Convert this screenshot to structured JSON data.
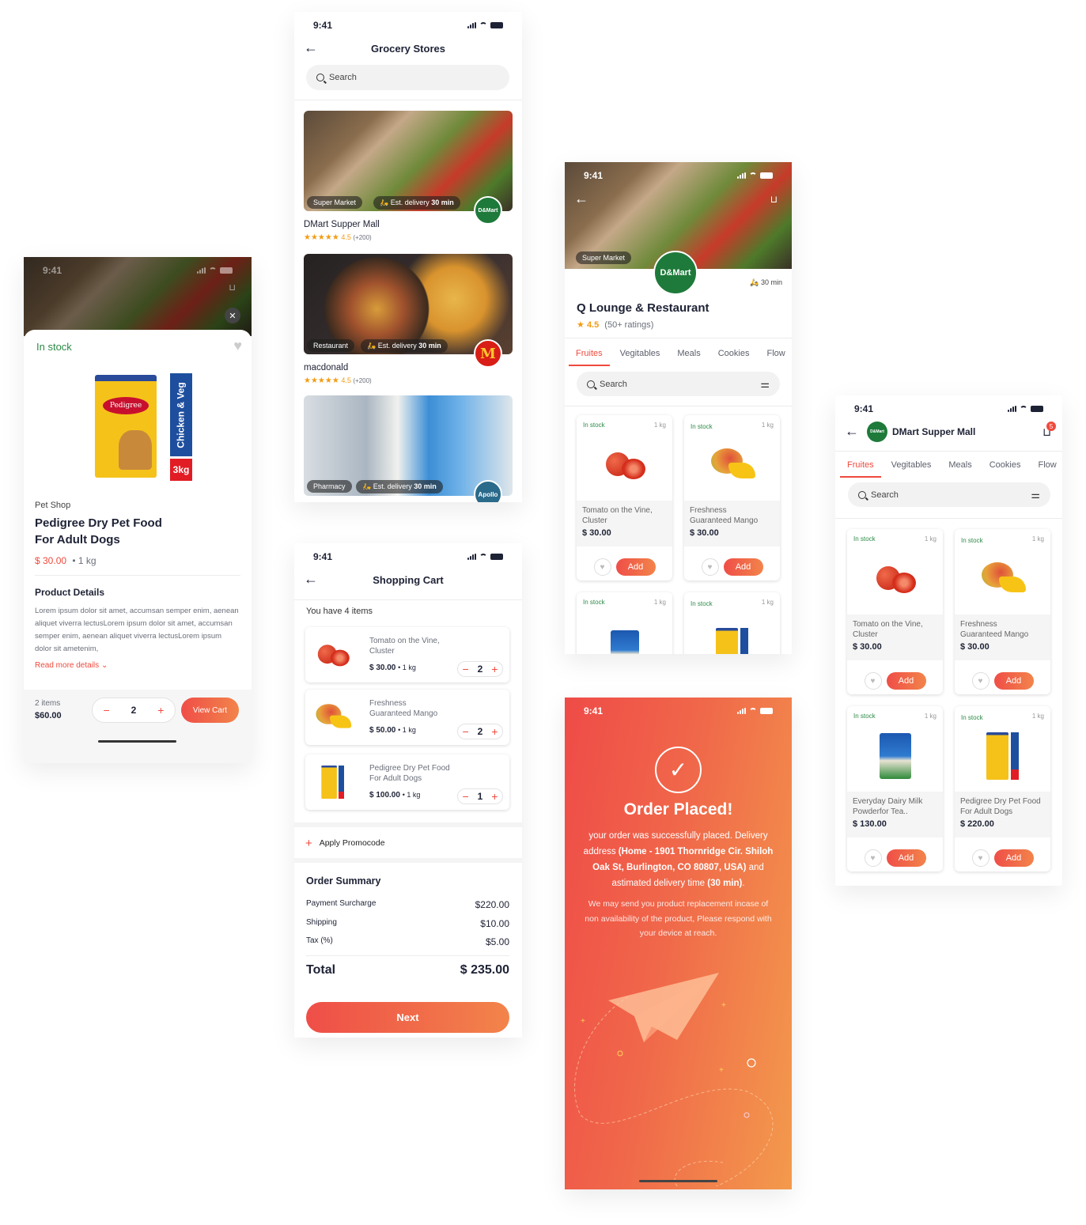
{
  "status_time": "9:41",
  "product_detail": {
    "stock": "In stock",
    "shop": "Pet Shop",
    "title_line1": "Pedigree Dry Pet Food",
    "title_line2": "For Adult Dogs",
    "price": "$ 30.00",
    "unit": "• 1 kg",
    "section_title": "Product Details",
    "description": "Lorem ipsum dolor sit amet, accumsan semper enim, aenean aliquet viverra lectusLorem ipsum dolor sit amet, accumsan semper enim, aenean aliquet viverra lectusLorem ipsum dolor sit ametenim,",
    "read_more": "Read more details",
    "pack_label": "Chicken & Veg",
    "pack_weight": "3kg",
    "footer": {
      "items": "2 items",
      "total": "$60.00",
      "qty": "2",
      "view_cart": "View Cart"
    }
  },
  "grocery_stores": {
    "title": "Grocery Stores",
    "search_placeholder": "Search",
    "stores": [
      {
        "category": "Super Market",
        "delivery_prefix": "Est. delivery",
        "delivery_time": "30 min",
        "name": "DMart Supper Mall",
        "rating": "4.5",
        "count": "(+200)",
        "logo": "D&Mart"
      },
      {
        "category": "Restaurant",
        "delivery_prefix": "Est. delivery",
        "delivery_time": "30 min",
        "name": "macdonald",
        "rating": "4.5",
        "count": "(+200)",
        "logo": "M"
      },
      {
        "category": "Pharmacy",
        "delivery_prefix": "Est. delivery",
        "delivery_time": "30 min",
        "name": "",
        "rating": "",
        "count": "",
        "logo": "Apollo"
      }
    ]
  },
  "cart": {
    "title": "Shopping Cart",
    "count_text": "You have 4 items",
    "items": [
      {
        "name1": "Tomato on the Vine,",
        "name2": "Cluster",
        "price": "$ 30.00",
        "unit": "• 1 kg",
        "qty": "2"
      },
      {
        "name1": "Freshness",
        "name2": "Guaranteed Mango",
        "price": "$ 50.00",
        "unit": "• 1 kg",
        "qty": "2"
      },
      {
        "name1": "Pedigree Dry Pet Food",
        "name2": "For Adult Dogs",
        "price": "$ 100.00",
        "unit": "• 1 kg",
        "qty": "1"
      }
    ],
    "promo": "Apply Promocode",
    "summary_title": "Order Summary",
    "rows": [
      {
        "label": "Payment Surcharge",
        "value": "$220.00"
      },
      {
        "label": "Shipping",
        "value": "$10.00"
      },
      {
        "label": "Tax (%)",
        "value": "$5.00"
      }
    ],
    "total_label": "Total",
    "total_value": "$ 235.00",
    "next": "Next"
  },
  "store_detail": {
    "category": "Super Market",
    "logo": "D&Mart",
    "delivery": "30 min",
    "name": "Q Lounge & Restaurant",
    "rating": "4.5",
    "ratings_count": "(50+ ratings)",
    "tabs": [
      "Fruites",
      "Vegitables",
      "Meals",
      "Cookies",
      "Flow"
    ],
    "search_placeholder": "Search",
    "products": [
      {
        "stock": "In stock",
        "weight": "1 kg",
        "name1": "Tomato on the Vine,",
        "name2": "Cluster",
        "price": "$ 30.00",
        "add": "Add"
      },
      {
        "stock": "In stock",
        "weight": "1 kg",
        "name1": "Freshness",
        "name2": "Guaranteed Mango",
        "price": "$ 30.00",
        "add": "Add"
      },
      {
        "stock": "In stock",
        "weight": "1 kg"
      },
      {
        "stock": "In stock",
        "weight": "1 kg"
      }
    ]
  },
  "order_placed": {
    "title": "Order Placed!",
    "msg_a": "your order was successfully placed. Delivery address ",
    "msg_addr": "(Home - 1901 Thornridge Cir. Shiloh Oak St, Burlington, CO 80807, USA)",
    "msg_b": " and astimated delivery time ",
    "msg_time": "(30 min)",
    "msg_c": ".",
    "note": "We may send you product replacement incase of non availability of the product, Please respond with your device at reach."
  },
  "store_listing": {
    "title": "DMart Supper Mall",
    "logo": "D&Mart",
    "cart_badge": "5",
    "tabs": [
      "Fruites",
      "Vegitables",
      "Meals",
      "Cookies",
      "Flow"
    ],
    "search_placeholder": "Search",
    "products": [
      {
        "stock": "In stock",
        "weight": "1 kg",
        "name1": "Tomato on the Vine,",
        "name2": "Cluster",
        "price": "$ 30.00",
        "add": "Add"
      },
      {
        "stock": "In stock",
        "weight": "1 kg",
        "name1": "Freshness",
        "name2": "Guaranteed Mango",
        "price": "$ 30.00",
        "add": "Add"
      },
      {
        "stock": "In stock",
        "weight": "1 kg",
        "name1": "Everyday Dairy Milk",
        "name2": "Powderfor Tea..",
        "price": "$ 130.00",
        "add": "Add"
      },
      {
        "stock": "In stock",
        "weight": "1 kg",
        "name1": "Pedigree Dry Pet Food",
        "name2": "For Adult Dogs",
        "price": "$ 220.00",
        "add": "Add"
      }
    ]
  },
  "colors": {
    "accent": "#f04a3d",
    "accent_end": "#f2844a",
    "stock_green": "#2d8a47",
    "star": "#f39c12",
    "dmart_green": "#1e7a3a"
  }
}
